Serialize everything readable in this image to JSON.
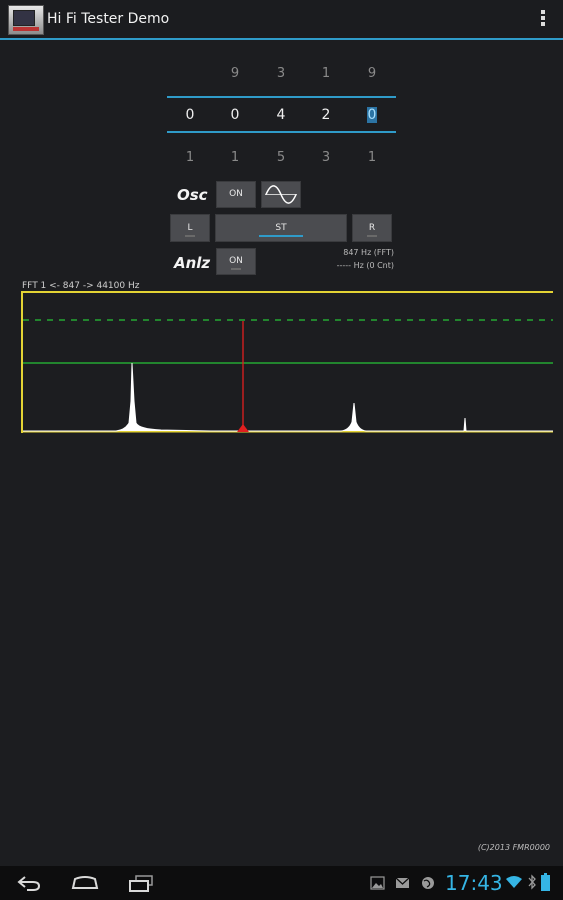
{
  "app": {
    "title": "Hi Fi Tester Demo"
  },
  "frequency_picker": {
    "above": [
      "9",
      "3",
      "1",
      "9"
    ],
    "current": [
      "0",
      "0",
      "4",
      "2",
      "0"
    ],
    "below": [
      "1",
      "1",
      "5",
      "3",
      "1"
    ],
    "selected_index": 4
  },
  "oscillator": {
    "label": "Osc",
    "toggle_label": "ON",
    "waveform": "sine-wave-icon"
  },
  "channels": {
    "left": "L",
    "stereo": "ST",
    "right": "R",
    "selected": "ST"
  },
  "analyzer": {
    "label": "Anlz",
    "toggle_label": "ON",
    "fft_readout": "847 Hz (FFT)",
    "count_readout": "----- Hz (0 Cnt)"
  },
  "spectrum": {
    "caption": "FFT 1 <- 847 -> 44100 Hz",
    "peak_frequency_hz": 847,
    "frequency_range_hz": [
      1,
      44100
    ],
    "colors": {
      "frame": "#e3d334",
      "threshold": "#27c437",
      "reference": "#27c437",
      "marker": "#e11f1f",
      "trace": "#ffffff"
    }
  },
  "footer": {
    "copyright": "(C)2013 FMR0000"
  },
  "system_bar": {
    "time": "17:43",
    "time_color": "#35b5e5"
  }
}
